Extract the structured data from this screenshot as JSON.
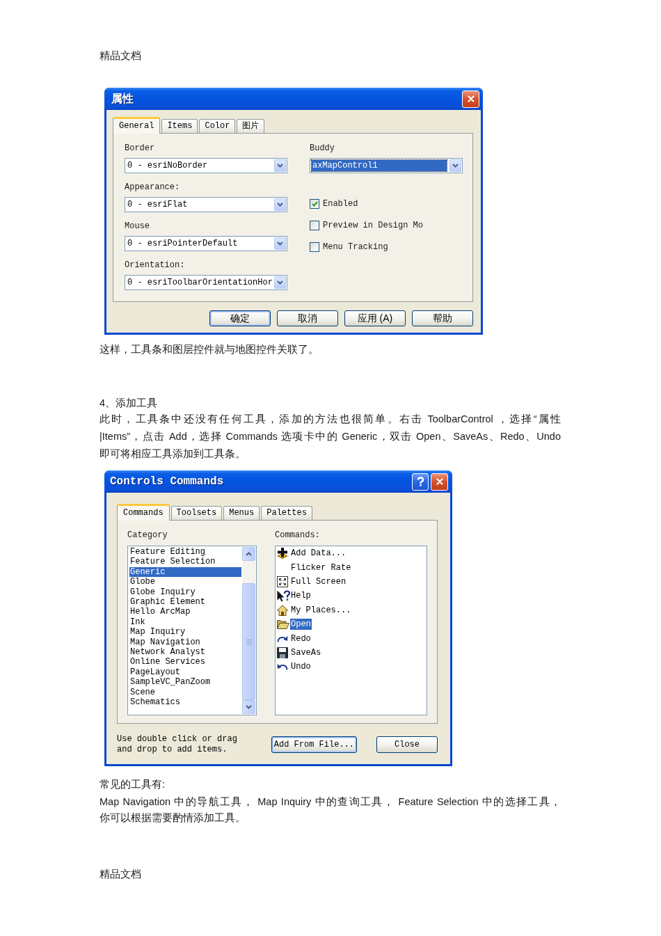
{
  "header": {
    "text": "精品文档"
  },
  "properties_dialog": {
    "title": "属性",
    "title_buttons": [
      {
        "kind": "close"
      }
    ],
    "tabs": [
      {
        "label": "General",
        "selected": true
      },
      {
        "label": "Items",
        "selected": false
      },
      {
        "label": "Color",
        "selected": false
      },
      {
        "label": "图片",
        "selected": false
      }
    ],
    "left_fields": [
      {
        "label": "Border",
        "value": "0 - esriNoBorder",
        "focused": false
      },
      {
        "label": "Appearance:",
        "value": "0 - esriFlat",
        "focused": false
      },
      {
        "label": "Mouse",
        "value": "0 - esriPointerDefault",
        "focused": false
      },
      {
        "label": "Orientation:",
        "value": "0 - esriToolbarOrientationHor",
        "focused": false
      }
    ],
    "right_field": {
      "label": "Buddy",
      "value": "axMapControl1",
      "focused": true
    },
    "checkboxes": [
      {
        "label": "Enabled",
        "checked": true
      },
      {
        "label": "Preview in Design Mo",
        "checked": false
      },
      {
        "label": "Menu Tracking",
        "checked": false
      }
    ],
    "buttons": [
      {
        "label": "确定",
        "default": true
      },
      {
        "label": "取消",
        "default": false
      },
      {
        "label": "应用 (A)",
        "default": false
      },
      {
        "label": "帮助",
        "default": false
      }
    ]
  },
  "caption": {
    "text": "这样，工具条和图层控件就与地图控件关联了。"
  },
  "heading": {
    "text": "4、添加工具"
  },
  "instructions": {
    "lines": [
      "此时，工具条中还没有任何工具，添加的方法也很简单。右击 ToolbarControl ，选择“属性",
      "|Items”，点击 Add，选择 Commands 选项卡中的 Generic，双击 Open、SaveAs、Redo、Undo",
      "即可将相应工具添加到工具条。"
    ]
  },
  "commands_dialog": {
    "title": "Controls Commands",
    "title_buttons": [
      {
        "kind": "help"
      },
      {
        "kind": "close"
      }
    ],
    "tabs": [
      {
        "label": "Commands",
        "selected": true
      },
      {
        "label": "Toolsets",
        "selected": false
      },
      {
        "label": "Menus",
        "selected": false
      },
      {
        "label": "Palettes",
        "selected": false
      }
    ],
    "category": {
      "label": "Category",
      "items": [
        {
          "label": "Feature Editing",
          "selected": false
        },
        {
          "label": "Feature Selection",
          "selected": false
        },
        {
          "label": "Generic",
          "selected": true
        },
        {
          "label": "Globe",
          "selected": false
        },
        {
          "label": "Globe Inquiry",
          "selected": false
        },
        {
          "label": "Graphic Element",
          "selected": false
        },
        {
          "label": "Hello ArcMap",
          "selected": false
        },
        {
          "label": "Ink",
          "selected": false
        },
        {
          "label": "Map Inquiry",
          "selected": false
        },
        {
          "label": "Map Navigation",
          "selected": false
        },
        {
          "label": "Network Analyst",
          "selected": false
        },
        {
          "label": "Online Services",
          "selected": false
        },
        {
          "label": "PageLayout",
          "selected": false
        },
        {
          "label": "SampleVC_PanZoom",
          "selected": false
        },
        {
          "label": "Scene",
          "selected": false
        },
        {
          "label": "Schematics",
          "selected": false
        }
      ]
    },
    "commands": {
      "label": "Commands:",
      "items": [
        {
          "label": "Add Data...",
          "kind": "add",
          "selected": false
        },
        {
          "label": "Flicker Rate",
          "kind": "none",
          "selected": false
        },
        {
          "label": "Full Screen",
          "kind": "fullscreen",
          "selected": false
        },
        {
          "label": "Help",
          "kind": "help",
          "selected": false
        },
        {
          "label": "My Places...",
          "kind": "places",
          "selected": false
        },
        {
          "label": "Open",
          "kind": "open",
          "selected": true
        },
        {
          "label": "Redo",
          "kind": "redo",
          "selected": false
        },
        {
          "label": "SaveAs",
          "kind": "save",
          "selected": false
        },
        {
          "label": "Undo",
          "kind": "undo",
          "selected": false
        }
      ]
    },
    "hint": "Use double click or drag and drop to add items.",
    "buttons": [
      {
        "label": "Add From File...",
        "default": true
      },
      {
        "label": "Close",
        "default": false
      }
    ]
  },
  "tools_intro": {
    "text": "常见的工具有:"
  },
  "tools_paragraph": {
    "lines": [
      "Map Navigation 中的导航工具， Map Inquiry 中的查询工具， Feature Selection 中的选择工具，",
      "你可以根据需要酌情添加工具。"
    ]
  },
  "footer": {
    "text": "精品文档"
  }
}
